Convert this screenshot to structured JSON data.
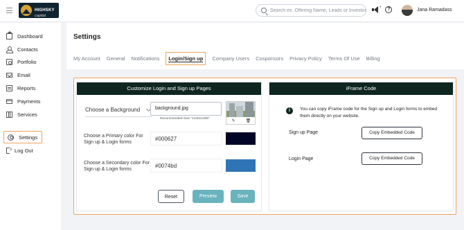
{
  "brand": {
    "name_line1": "HIGHSKY",
    "name_line2": "capital"
  },
  "search": {
    "placeholder": "Search ex. Offering Name, Leads or Investors"
  },
  "header": {
    "megaphone_badge": "*",
    "help_symbol": "?",
    "user_name": "Jana Ramadass"
  },
  "sidebar": {
    "items": [
      {
        "label": "Dashboard",
        "icon": "home-icon"
      },
      {
        "label": "Contacts",
        "icon": "users-icon"
      },
      {
        "label": "Portfolio",
        "icon": "portfolio-icon"
      },
      {
        "label": "Email",
        "icon": "mail-icon"
      },
      {
        "label": "Reports",
        "icon": "report-icon"
      },
      {
        "label": "Payments",
        "icon": "card-icon"
      },
      {
        "label": "Services",
        "icon": "services-icon"
      },
      {
        "label": "Settings",
        "icon": "gear-icon",
        "active": true
      },
      {
        "label": "Log Out",
        "icon": "logout-icon"
      }
    ]
  },
  "page": {
    "title": "Settings",
    "tabs": [
      {
        "label": "My Account"
      },
      {
        "label": "General"
      },
      {
        "label": "Notifications"
      },
      {
        "label": "Login/Sign up",
        "active": true
      },
      {
        "label": "Company Users"
      },
      {
        "label": "Cosponsors"
      },
      {
        "label": "Privacy Policy"
      },
      {
        "label": "Terms Of Use"
      },
      {
        "label": "Billing"
      }
    ]
  },
  "customize": {
    "heading": "Customize Login and Sign up Pages",
    "background_select": "Choose a Background",
    "background_file": "background.jpg",
    "recommended_size": "Recommended Size \"1440x1005\"",
    "thumb_actions": {
      "edit": "✎",
      "delete": "🗑"
    },
    "primary_label": "Choose a Primary color For Sign up & Login forms",
    "primary_value": "#000627",
    "secondary_label": "Choose a Secondary color For Sign up & Login forms",
    "secondary_value": "#0074bd",
    "primary_swatch": "#000627",
    "secondary_swatch": "#2f75b5",
    "buttons": {
      "reset": "Reset",
      "preview": "Preview",
      "save": "Save"
    }
  },
  "iframe": {
    "heading": "iFrame Code",
    "info_symbol": "i",
    "info_text": "You can copy iFrame code for the Sign up and Login forms to embed them directly on your website.",
    "rows": [
      {
        "label": "Sign up Page",
        "button": "Copy Embedded Code"
      },
      {
        "label": "Login Page",
        "button": "Copy Embedded Code"
      }
    ]
  },
  "colors": {
    "accent_highlight": "#f0a35c",
    "header_dark": "#0f2620",
    "button_teal": "#68b3bd"
  }
}
